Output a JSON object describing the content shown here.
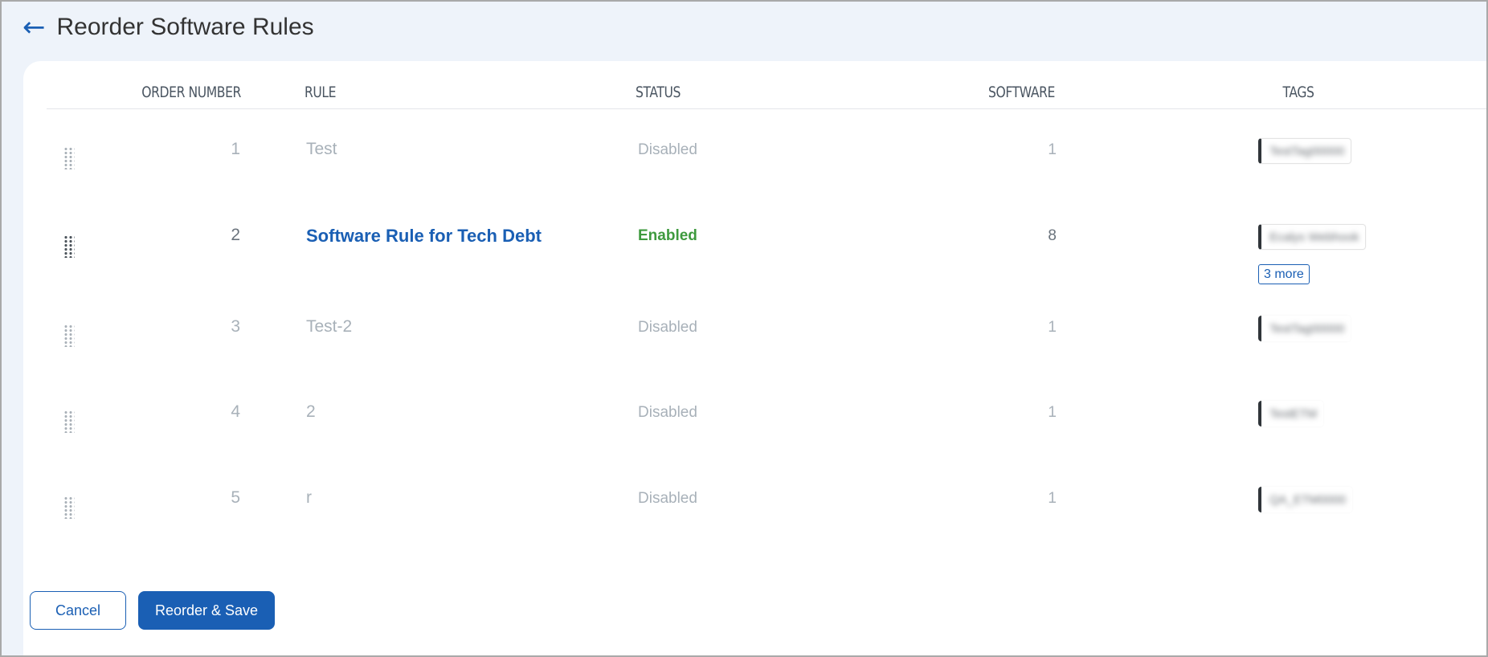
{
  "header": {
    "back_icon": "arrow-left-icon",
    "title": "Reorder Software Rules"
  },
  "table": {
    "columns": [
      "ORDER NUMBER",
      "RULE",
      "STATUS",
      "SOFTWARE",
      "TAGS"
    ],
    "rows": [
      {
        "order": "1",
        "rule": "Test",
        "status": "Disabled",
        "software": "1",
        "tag": "TestTag00000"
      },
      {
        "order": "2",
        "rule": "Software Rule for Tech Debt",
        "status": "Enabled",
        "software": "8",
        "tag": "Ecalys Webhook",
        "more": "3 more"
      },
      {
        "order": "3",
        "rule": "Test-2",
        "status": "Disabled",
        "software": "1",
        "tag": "TestTag00000"
      },
      {
        "order": "4",
        "rule": "2",
        "status": "Disabled",
        "software": "1",
        "tag": "TestETM"
      },
      {
        "order": "5",
        "rule": "r",
        "status": "Disabled",
        "software": "1",
        "tag": "QA_ETM0000"
      }
    ]
  },
  "footer": {
    "cancel_label": "Cancel",
    "save_label": "Reorder & Save"
  },
  "colors": {
    "primary": "#1a5fb4",
    "enabled": "#3e9a3e",
    "disabled_text": "#a8b1b9",
    "background": "#eef3fa"
  }
}
